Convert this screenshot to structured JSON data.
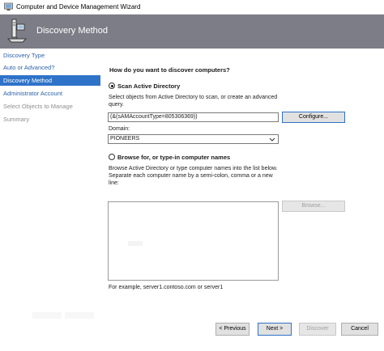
{
  "window": {
    "title": "Computer and Device Management Wizard"
  },
  "banner": {
    "title": "Discovery Method"
  },
  "sidebar": {
    "items": [
      {
        "label": "Discovery Type",
        "state": "link"
      },
      {
        "label": "Auto or Advanced?",
        "state": "link"
      },
      {
        "label": "Discovery Method",
        "state": "active"
      },
      {
        "label": "Administrator Account",
        "state": "link"
      },
      {
        "label": "Select Objects to Manage",
        "state": "disabled"
      },
      {
        "label": "Summary",
        "state": "disabled"
      }
    ]
  },
  "main": {
    "question": "How do you want to discover computers?",
    "scan_ad": {
      "label": "Scan Active Directory",
      "selected": true,
      "description": "Select objects from Active Directory to scan, or create an advanced query.",
      "query_value": "(&(sAMAccountType=805306369))",
      "configure_label": "Configure...",
      "domain_label": "Domain:",
      "domain_value": "PIONEERS"
    },
    "browse": {
      "label": "Browse for, or type-in computer names",
      "selected": false,
      "description": "Browse Active Directory or type computer names into the list below. Separate each computer name by a semi-colon, comma or a new line:",
      "browse_label": "Browse...",
      "example": "For example, server1.contoso.com or server1"
    }
  },
  "footer": {
    "previous_label": "< Previous",
    "next_label": "Next >",
    "discover_label": "Discover",
    "cancel_label": "Cancel"
  },
  "colors": {
    "banner": "#7d7d87",
    "nav_active": "#2f73c9",
    "nav_link": "#2d63a8",
    "disabled_text": "#8f8f8f"
  }
}
